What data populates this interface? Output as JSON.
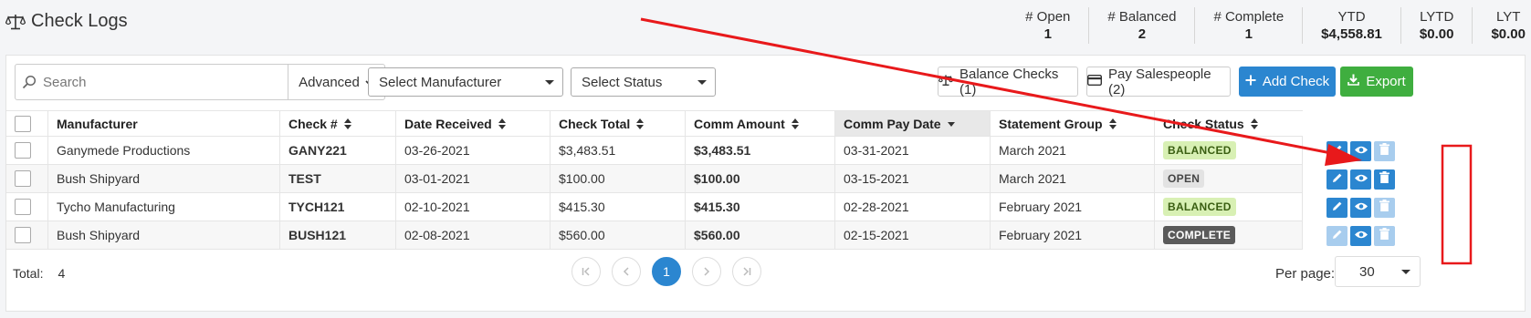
{
  "page": {
    "title": "Check Logs",
    "icon": "scale-icon"
  },
  "stats": [
    {
      "label": "# Open",
      "value": "1"
    },
    {
      "label": "# Balanced",
      "value": "2"
    },
    {
      "label": "# Complete",
      "value": "1"
    },
    {
      "label": "YTD",
      "value": "$4,558.81"
    },
    {
      "label": "LYTD",
      "value": "$0.00"
    },
    {
      "label": "LYT",
      "value": "$0.00"
    }
  ],
  "toolbar": {
    "search_placeholder": "Search",
    "advanced_label": "Advanced",
    "manufacturer_select": "Select Manufacturer",
    "status_select": "Select Status",
    "balance_checks": "Balance Checks (1)",
    "pay_salespeople": "Pay Salespeople (2)",
    "add_check": "Add Check",
    "export": "Export"
  },
  "table": {
    "columns": [
      "Manufacturer",
      "Check #",
      "Date Received",
      "Check Total",
      "Comm Amount",
      "Comm Pay Date",
      "Statement Group",
      "Check Status"
    ],
    "rows": [
      {
        "manufacturer": "Ganymede Productions",
        "check_no": "GANY221",
        "date_received": "03-26-2021",
        "check_total": "$3,483.51",
        "comm_amount": "$3,483.51",
        "comm_pay_date": "03-31-2021",
        "statement_group": "March 2021",
        "status": "BALANCED"
      },
      {
        "manufacturer": "Bush Shipyard",
        "check_no": "TEST",
        "date_received": "03-01-2021",
        "check_total": "$100.00",
        "comm_amount": "$100.00",
        "comm_pay_date": "03-15-2021",
        "statement_group": "March 2021",
        "status": "OPEN"
      },
      {
        "manufacturer": "Tycho Manufacturing",
        "check_no": "TYCH121",
        "date_received": "02-10-2021",
        "check_total": "$415.30",
        "comm_amount": "$415.30",
        "comm_pay_date": "02-28-2021",
        "statement_group": "February 2021",
        "status": "BALANCED"
      },
      {
        "manufacturer": "Bush Shipyard",
        "check_no": "BUSH121",
        "date_received": "02-08-2021",
        "check_total": "$560.00",
        "comm_amount": "$560.00",
        "comm_pay_date": "02-15-2021",
        "statement_group": "February 2021",
        "status": "COMPLETE"
      }
    ]
  },
  "footer": {
    "total_label": "Total:",
    "total_value": "4",
    "current_page": "1",
    "per_page_label": "Per page:",
    "per_page_value": "30"
  },
  "colors": {
    "primary": "#2b86d0",
    "success": "#3fae3f",
    "annotation": "#e8191b"
  }
}
